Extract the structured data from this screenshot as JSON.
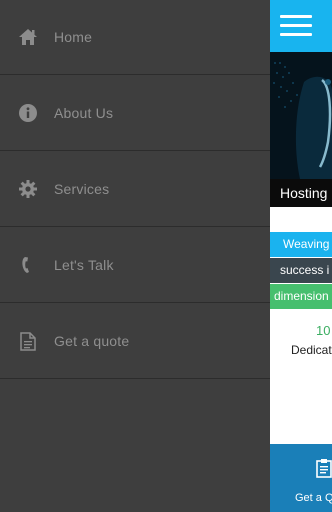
{
  "drawer": {
    "items": [
      {
        "label": "Home",
        "icon": "home-icon"
      },
      {
        "label": "About Us",
        "icon": "info-icon"
      },
      {
        "label": "Services",
        "icon": "gear-icon"
      },
      {
        "label": "Let's Talk",
        "icon": "phone-icon"
      },
      {
        "label": "Get a quote",
        "icon": "document-icon"
      }
    ]
  },
  "content": {
    "hero_caption": "Hosting",
    "band_1": "Weaving",
    "band_2": "success i",
    "band_3": "dimension",
    "stat_number": "10",
    "stat_label": "Dedicat",
    "bottom_label": "Get a Q"
  },
  "colors": {
    "accent": "#18b4ef",
    "drawer_bg": "#3e3e3e",
    "green": "#46bf6e",
    "bottom_bar": "#1a7fb8"
  }
}
